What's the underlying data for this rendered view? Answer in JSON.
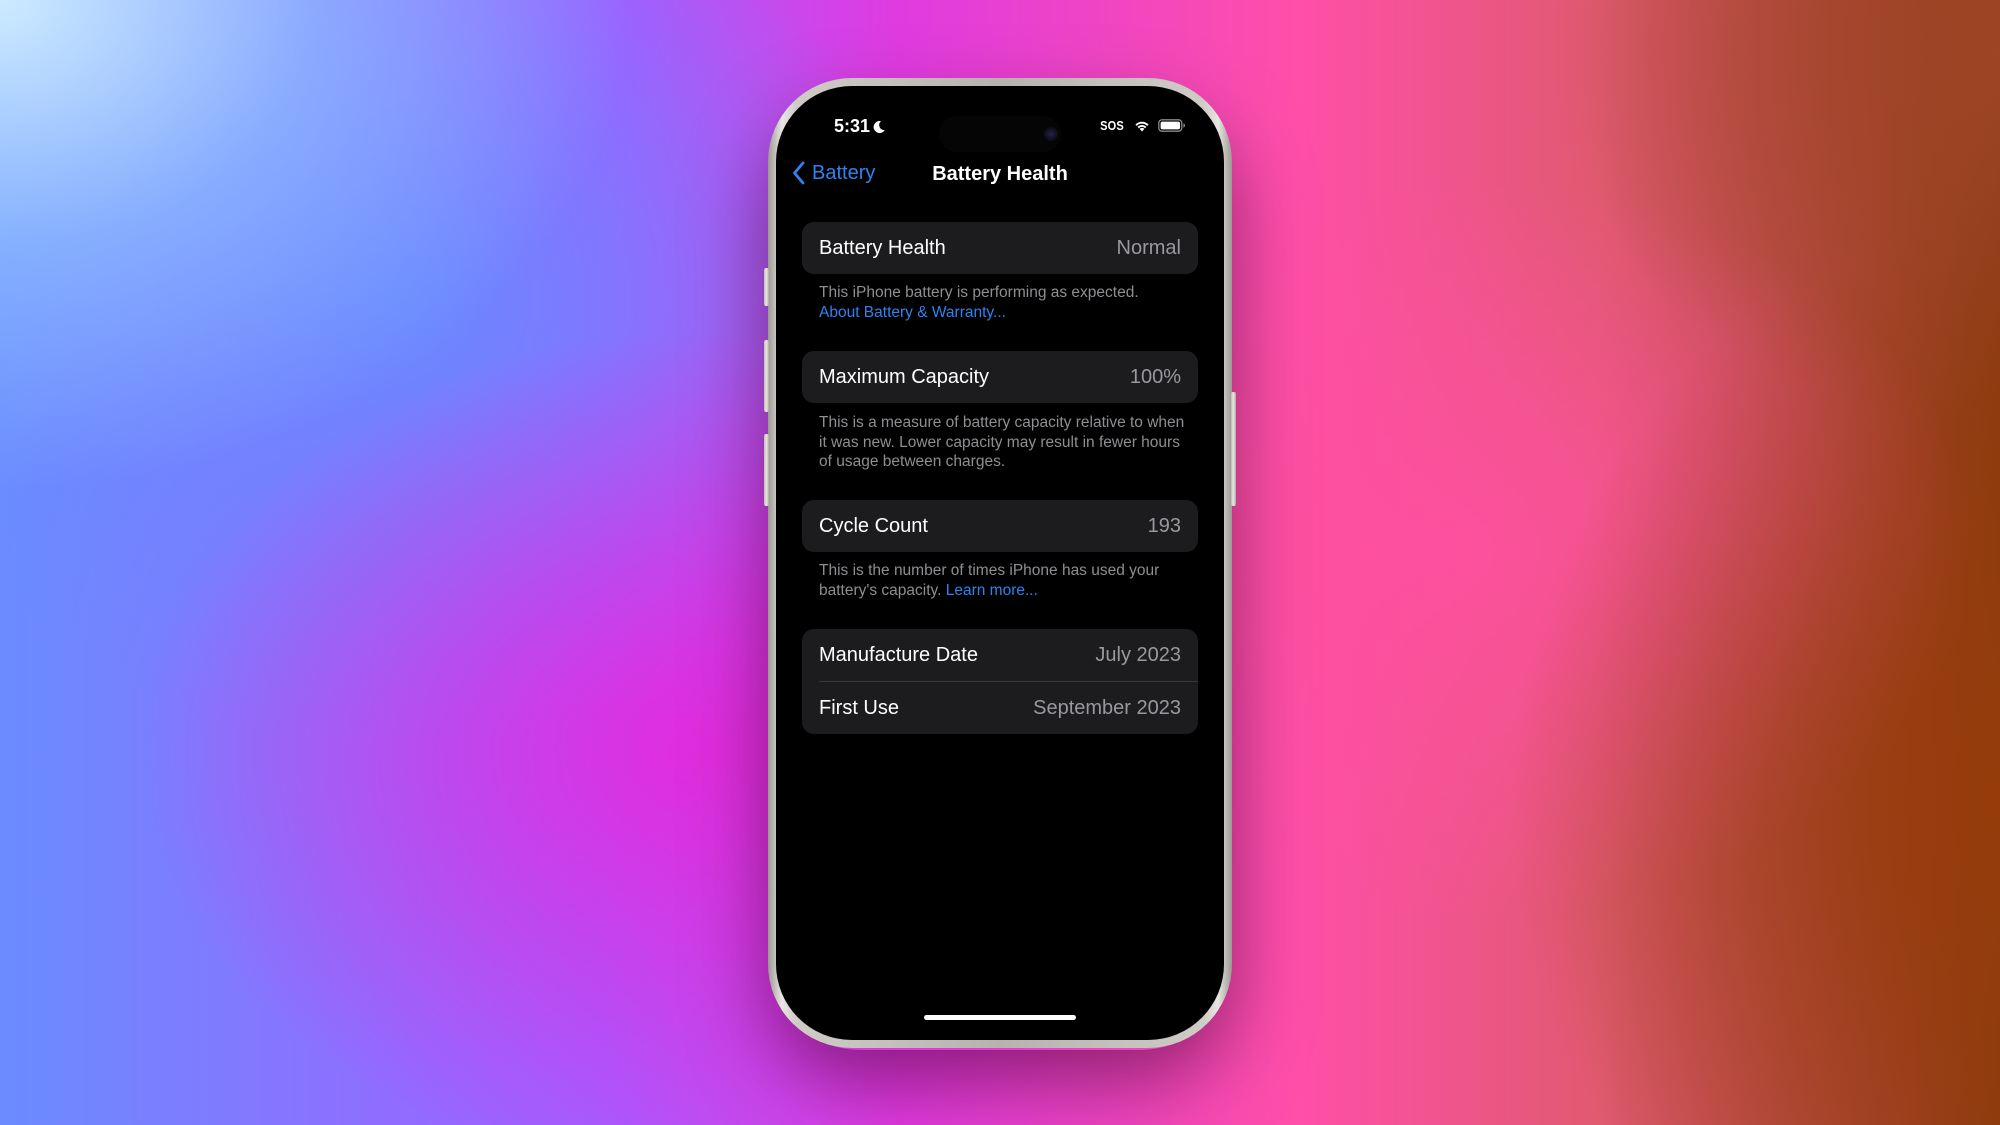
{
  "status_bar": {
    "time": "5:31",
    "focus_icon": "moon-icon",
    "carrier": "SOS",
    "wifi_icon": "wifi-icon",
    "battery_icon": "battery-icon"
  },
  "nav": {
    "back_label": "Battery",
    "back_icon": "chevron-left-icon",
    "title": "Battery Health"
  },
  "sections": [
    {
      "rows": [
        {
          "label": "Battery Health",
          "value": "Normal"
        }
      ],
      "footer": "This iPhone battery is performing as expected.",
      "footer_link": "About Battery & Warranty..."
    },
    {
      "rows": [
        {
          "label": "Maximum Capacity",
          "value": "100%"
        }
      ],
      "footer": "This is a measure of battery capacity relative to when it was new. Lower capacity may result in fewer hours of usage between charges."
    },
    {
      "rows": [
        {
          "label": "Cycle Count",
          "value": "193"
        }
      ],
      "footer": "This is the number of times iPhone has used your battery's capacity.",
      "footer_link": "Learn more..."
    },
    {
      "rows": [
        {
          "label": "Manufacture Date",
          "value": "July 2023"
        },
        {
          "label": "First Use",
          "value": "September 2023"
        }
      ]
    }
  ],
  "colors": {
    "accent": "#2f83f0",
    "card_bg": "#1c1c1e",
    "secondary_text": "#98989e",
    "footer_text": "#8e8e93"
  }
}
